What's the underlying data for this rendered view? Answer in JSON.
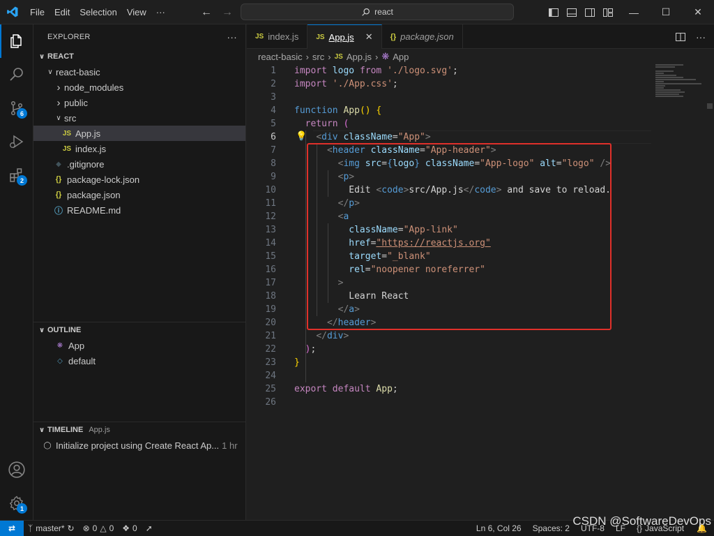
{
  "menu": {
    "items": [
      "File",
      "Edit",
      "Selection",
      "View"
    ],
    "more": "···"
  },
  "search": {
    "text": "react"
  },
  "explorer": {
    "title": "EXPLORER",
    "more": "···",
    "section": "REACT",
    "tree": [
      {
        "label": "react-basic",
        "type": "folder",
        "expanded": true,
        "depth": 1
      },
      {
        "label": "node_modules",
        "type": "folder",
        "expanded": false,
        "depth": 2
      },
      {
        "label": "public",
        "type": "folder",
        "expanded": false,
        "depth": 2
      },
      {
        "label": "src",
        "type": "folder",
        "expanded": true,
        "depth": 2
      },
      {
        "label": "App.js",
        "type": "js",
        "depth": 3,
        "selected": true
      },
      {
        "label": "index.js",
        "type": "js",
        "depth": 3
      },
      {
        "label": ".gitignore",
        "type": "git",
        "depth": 2
      },
      {
        "label": "package-lock.json",
        "type": "json",
        "depth": 2
      },
      {
        "label": "package.json",
        "type": "json",
        "depth": 2
      },
      {
        "label": "README.md",
        "type": "info",
        "depth": 2
      }
    ]
  },
  "outline": {
    "title": "OUTLINE",
    "items": [
      "App",
      "default"
    ]
  },
  "timeline": {
    "title": "TIMELINE",
    "file": "App.js",
    "entry": "Initialize project using Create React Ap...",
    "time": "1 hr"
  },
  "activity": {
    "scm_badge": "6",
    "ext_badge": "2",
    "settings_badge": "1"
  },
  "tabs": [
    {
      "label": "index.js",
      "icon": "JS",
      "active": false,
      "italic": false
    },
    {
      "label": "App.js",
      "icon": "JS",
      "active": true,
      "italic": false
    },
    {
      "label": "package.json",
      "icon": "{}",
      "active": false,
      "italic": true
    }
  ],
  "breadcrumb": [
    "react-basic",
    "src",
    "App.js",
    "App"
  ],
  "code": {
    "current_line": 6,
    "line_numbers": [
      "1",
      "2",
      "3",
      "4",
      "5",
      "6",
      "7",
      "8",
      "9",
      "10",
      "11",
      "12",
      "13",
      "14",
      "15",
      "16",
      "17",
      "18",
      "19",
      "20",
      "21",
      "22",
      "23",
      "24",
      "25",
      "26"
    ]
  },
  "status": {
    "branch": "master*",
    "errors": "0",
    "warnings": "0",
    "ports": "0",
    "position": "Ln 6, Col 26",
    "spaces": "Spaces: 2",
    "encoding": "UTF-8",
    "eol": "LF",
    "language": "JavaScript"
  },
  "watermark": "CSDN @SoftwareDevOps",
  "colors": {
    "accent": "#0078d4",
    "highlight_box": "#e0302a"
  }
}
